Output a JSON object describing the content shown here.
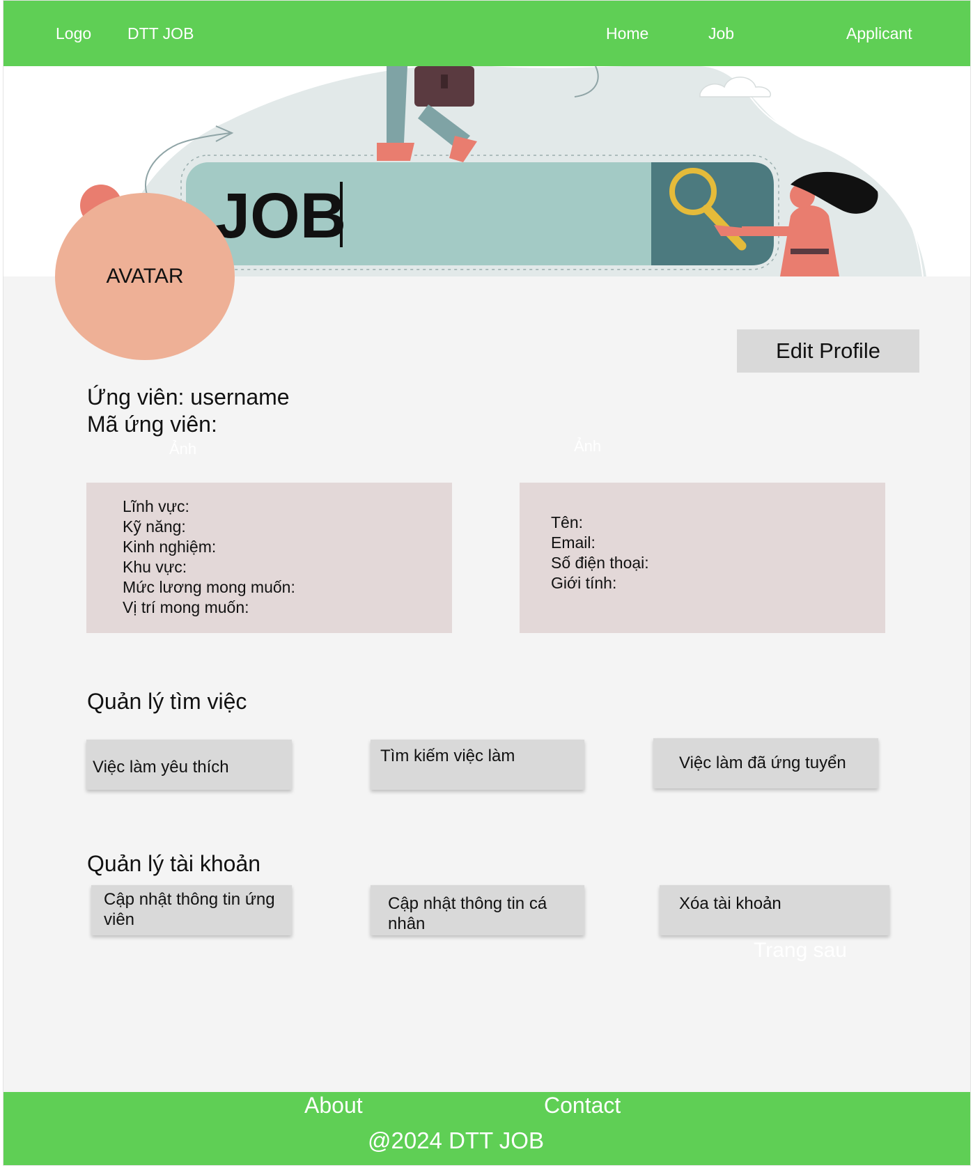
{
  "header": {
    "logo": "Logo",
    "brand": "DTT JOB",
    "nav": {
      "home": "Home",
      "job": "Job",
      "applicant": "Applicant"
    }
  },
  "banner": {
    "search_word": "JOB"
  },
  "avatar": {
    "label": "AVATAR"
  },
  "profile": {
    "edit_label": "Edit Profile",
    "candidate_line": "Ứng viên: username",
    "code_line": "Mã ứng viên:",
    "ghost_left": "Ảnh",
    "ghost_right": "Ảnh"
  },
  "career_info": {
    "fields": [
      "Lĩnh vực:",
      "Kỹ năng:",
      "Kinh nghiệm:",
      "Khu vực:",
      "Mức lương mong muốn:",
      "Vị trí mong muốn:"
    ]
  },
  "personal_info": {
    "fields": [
      "Tên:",
      "Email:",
      "Số điện thoại:",
      "Giới tính:"
    ]
  },
  "job_management": {
    "title": "Quản lý tìm việc",
    "favorite_jobs": "Việc làm yêu thích",
    "search_jobs": "Tìm kiếm việc làm",
    "applied_jobs": "Việc làm đã ứng tuyển"
  },
  "account_management": {
    "title": "Quản lý tài khoản",
    "update_candidate_1": "Cập nhật thông tin ứng",
    "update_candidate_2": "viên",
    "update_personal_1": "Cập nhật thông tin cá",
    "update_personal_2": "nhân",
    "delete_account": "Xóa tài khoản",
    "next_page": "Trang sau"
  },
  "footer": {
    "about": "About",
    "contact": "Contact",
    "copyright": "@2024 DTT JOB"
  },
  "colors": {
    "header_green": "#5fcf55",
    "avatar": "#eeb096",
    "info_box": "#e3d8d8",
    "button_gray": "#d9d9d9"
  }
}
